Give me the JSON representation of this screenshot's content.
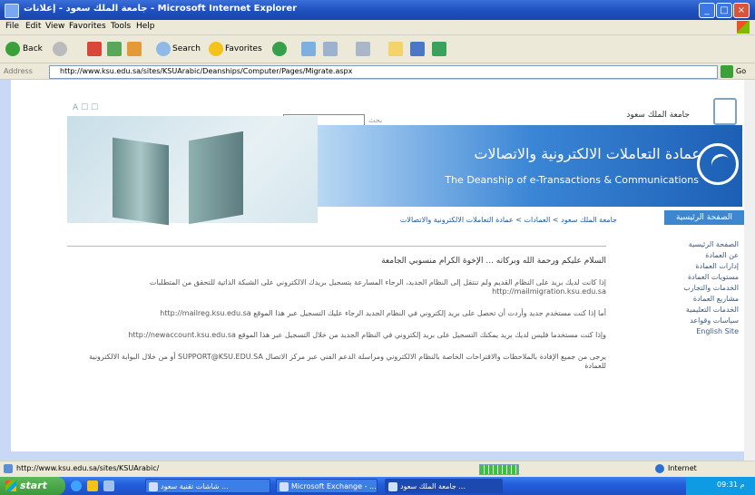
{
  "window": {
    "title": "جامعة الملك سعود - إعلانات - Microsoft Internet Explorer",
    "min_label": "_",
    "max_label": "□",
    "close_label": "×"
  },
  "menu": [
    "File",
    "Edit",
    "View",
    "Favorites",
    "Tools",
    "Help"
  ],
  "toolbar": {
    "back": "Back",
    "search": "Search",
    "favorites": "Favorites"
  },
  "address": {
    "label": "Address",
    "url": "http://www.ksu.edu.sa/sites/KSUArabic/Deanships/Computer/Pages/Migrate.aspx",
    "go": "Go"
  },
  "page": {
    "top_icons": "A ☐ ☐",
    "search_label": "بحث",
    "university_name": "جامعة الملك سعود",
    "banner_ar": "عمادة التعاملات الالكترونية والاتصالات",
    "banner_en": "The Deanship of e-Transactions & Communications",
    "breadcrumb": "جامعة الملك سعود > العمادات > عمادة التعاملات الالكترونية والاتصالات",
    "sidebar_title": "الصفحة الرئيسية",
    "sidebar_items": [
      "الصفحة الرئيسية",
      "عن العمادة",
      "إدارات العمادة",
      "مستويات العمادة",
      "الخدمات والتجارب",
      "مشاريع العمادة",
      "الخدمات التعليمية",
      "سياسات وقواعد",
      "English Site"
    ],
    "paragraphs": [
      "السلام عليكم ورحمة الله وبركاته ... الإخوة الكرام منسوبي الجامعة",
      "إذا كانت لديك بريد على النظام القديم ولم تنتقل إلى النظام الجديد، الرجاء المسارعة بتسجيل بريدك الالكتروني على الشبكة الذاتية للتحقق من المتطلبات http://mailmigration.ksu.edu.sa",
      "أما إذا كنت مستخدم جديد وأردت أن تحصل على بريد إلكتروني في النظام الجديد الرجاء عليك التسجيل عبر هذا الموقع http://mailreg.ksu.edu.sa",
      "وإذا كنت مستخدما فليس لديك بريد يمكنك التسجيل على بريد إلكتروني في النظام الجديد من خلال التسجيل عبر هذا الموقع http://newaccount.ksu.edu.sa",
      "يرجى من جميع الإفادة بالملاحظات والاقتراحات الخاصة بالنظام الالكتروني ومراسلة الدعم الفني عبر مركز الاتصال SUPPORT@KSU.EDU.SA أو من خلال البوابة الالكترونية للعمادة"
    ]
  },
  "status": {
    "text": "http://www.ksu.edu.sa/sites/KSUArabic/",
    "progress": 1.0,
    "zone": "Internet"
  },
  "taskbar": {
    "start": "start",
    "tasks": [
      "شاشات تقنية سعود ...",
      "Microsoft Exchange - ...",
      "جامعة الملك سعود ..."
    ],
    "clock": "09:31 م"
  },
  "colors": {
    "titlebar": "#1e4fbf",
    "banner": "#3b86d6",
    "start": "#3b9a3b"
  }
}
